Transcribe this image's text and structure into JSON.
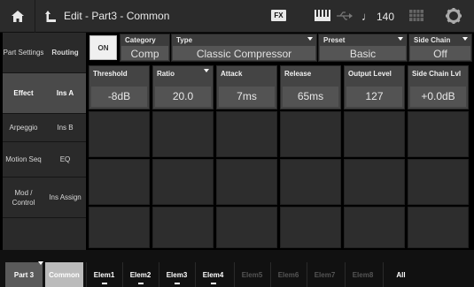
{
  "topbar": {
    "title": "Edit - Part3 - Common",
    "fx_badge": "FX",
    "tempo_symbol": "♩",
    "tempo": "140"
  },
  "left_tabs_col1": [
    {
      "label": "Part Settings",
      "active": false
    },
    {
      "label": "Effect",
      "active": true
    },
    {
      "label": "Arpeggio",
      "active": false
    },
    {
      "label": "Motion Seq",
      "active": false
    },
    {
      "label": "Mod / Control",
      "active": false
    }
  ],
  "left_tabs_col2": [
    {
      "label": "Routing",
      "active": false
    },
    {
      "label": "Ins A",
      "active": true
    },
    {
      "label": "Ins B",
      "active": false
    },
    {
      "label": "EQ",
      "active": false
    },
    {
      "label": "Ins Assign",
      "active": false
    }
  ],
  "header": {
    "on_label": "ON",
    "category": {
      "label": "Category",
      "value": "Comp"
    },
    "type": {
      "label": "Type",
      "value": "Classic Compressor"
    },
    "preset": {
      "label": "Preset",
      "value": "Basic"
    },
    "side_chain": {
      "label": "Side Chain",
      "value": "Off"
    }
  },
  "params": [
    {
      "label": "Threshold",
      "value": "-8dB"
    },
    {
      "label": "Ratio",
      "value": "20.0"
    },
    {
      "label": "Attack",
      "value": "7ms"
    },
    {
      "label": "Release",
      "value": "65ms"
    },
    {
      "label": "Output Level",
      "value": "127"
    },
    {
      "label": "Side Chain Lvl",
      "value": "+0.0dB"
    }
  ],
  "bottom": {
    "part_label": "Part 3",
    "common_label": "Common",
    "elements": [
      {
        "label": "Elem1",
        "enabled": true
      },
      {
        "label": "Elem2",
        "enabled": true
      },
      {
        "label": "Elem3",
        "enabled": true
      },
      {
        "label": "Elem4",
        "enabled": true
      },
      {
        "label": "Elem5",
        "enabled": false
      },
      {
        "label": "Elem6",
        "enabled": false
      },
      {
        "label": "Elem7",
        "enabled": false
      },
      {
        "label": "Elem8",
        "enabled": false
      },
      {
        "label": "All",
        "enabled": true
      }
    ]
  },
  "icons": {
    "home": "home-icon",
    "back": "back-arrow-icon",
    "keyboard": "keyboard-icon",
    "usb": "usb-icon",
    "grid": "grid-icon",
    "settings": "gear-icon"
  }
}
